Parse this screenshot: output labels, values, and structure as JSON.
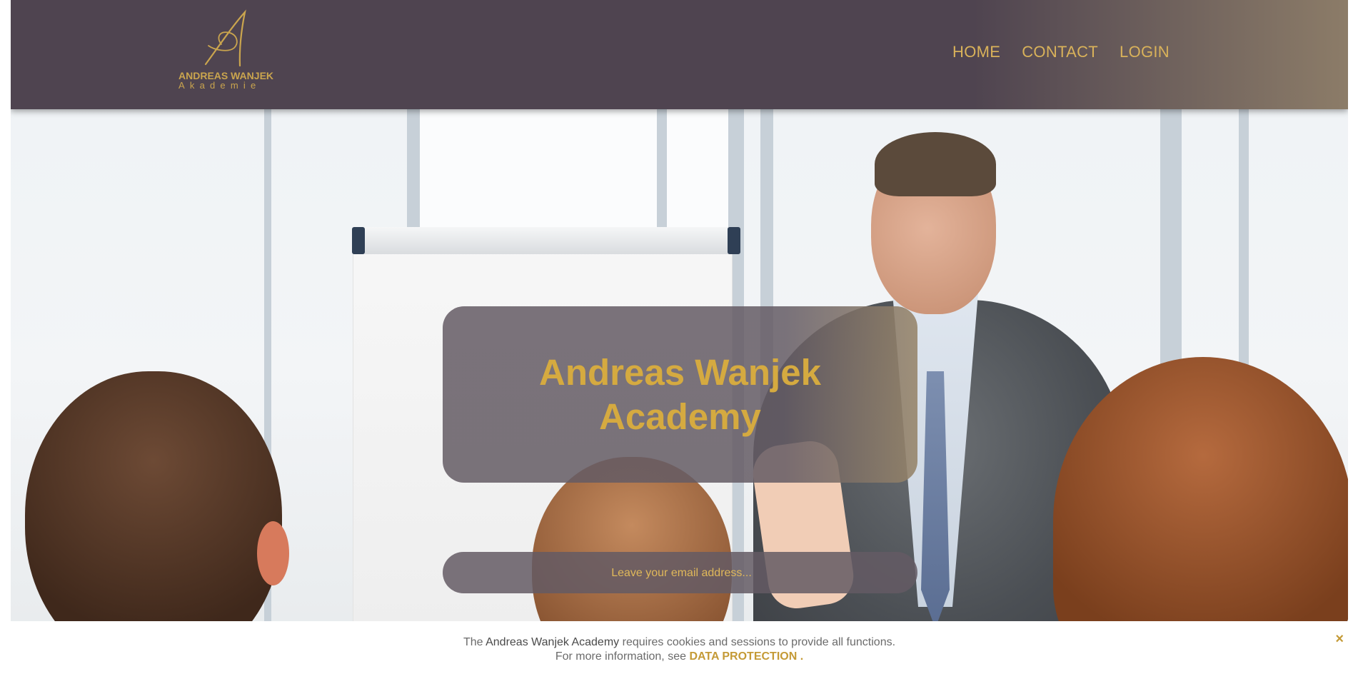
{
  "brand": {
    "logo_line1": "ANDREAS WANJEK",
    "logo_line2": "Akademie",
    "logo_color": "#caa54e"
  },
  "nav": {
    "items": [
      {
        "label": "HOME"
      },
      {
        "label": "CONTACT"
      },
      {
        "label": "LOGIN"
      }
    ]
  },
  "hero": {
    "title": "Andreas Wanjek Academy",
    "email_placeholder": "Leave your email address..."
  },
  "cookie_notice": {
    "prefix": "The",
    "brand": "Andreas Wanjek Academy",
    "text": "requires cookies and sessions to provide all functions.",
    "more_info": "For more information, see",
    "link": "DATA PROTECTION",
    "suffix": ".",
    "close": "×"
  },
  "colors": {
    "header": "#4f4450",
    "accent": "#d9b25a",
    "overlay": "#645b64"
  }
}
